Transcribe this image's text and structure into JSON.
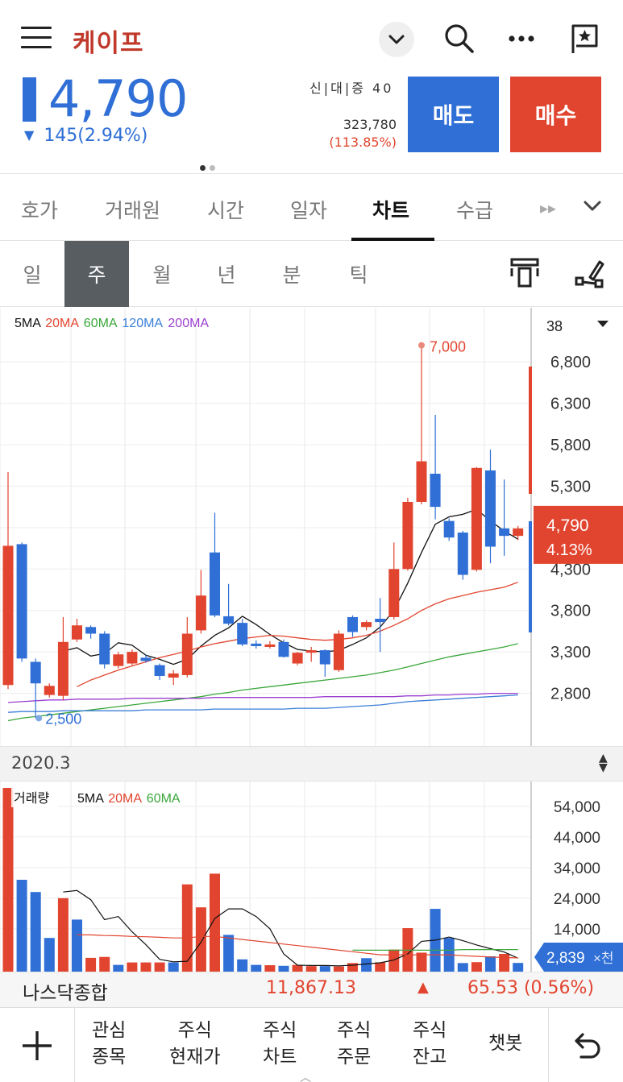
{
  "header": {
    "stock_name": "케이프",
    "icons": [
      "menu-icon",
      "chevron-down-icon",
      "search-icon",
      "more-icon",
      "bookmark-star-icon"
    ]
  },
  "quote": {
    "price": "4,790",
    "change": "145(2.94%)",
    "direction": "down",
    "credit_label": "신|대|증",
    "credit_value": "40",
    "volume": "323,780",
    "volume_pct": "(113.85%)",
    "sell_label": "매도",
    "buy_label": "매수",
    "colors": {
      "up": "#e2452f",
      "down": "#2f6fd6"
    }
  },
  "tabs": [
    {
      "label": "호가",
      "active": false
    },
    {
      "label": "거래원",
      "active": false
    },
    {
      "label": "시간",
      "active": false
    },
    {
      "label": "일자",
      "active": false
    },
    {
      "label": "차트",
      "active": true
    },
    {
      "label": "수급",
      "active": false
    }
  ],
  "periods": [
    {
      "label": "일",
      "active": false
    },
    {
      "label": "주",
      "active": true
    },
    {
      "label": "월",
      "active": false
    },
    {
      "label": "년",
      "active": false
    },
    {
      "label": "분",
      "active": false
    },
    {
      "label": "틱",
      "active": false
    }
  ],
  "price_chart": {
    "ma_legend": [
      {
        "label": "5MA",
        "color": "#111111"
      },
      {
        "label": "20MA",
        "color": "#e2452f"
      },
      {
        "label": "60MA",
        "color": "#3aa63a"
      },
      {
        "label": "120MA",
        "color": "#3b7fd8"
      },
      {
        "label": "200MA",
        "color": "#9b3fd0"
      }
    ],
    "candle_count": "38",
    "max_label": "7,000",
    "min_label": "2,500",
    "current_price": "4,790",
    "current_pct": "4.13%"
  },
  "date_bar": {
    "label": "2020.3"
  },
  "volume_chart": {
    "title": "거래량",
    "ma_legend": [
      {
        "label": "5MA",
        "color": "#111111"
      },
      {
        "label": "20MA",
        "color": "#e2452f"
      },
      {
        "label": "60MA",
        "color": "#3aa63a"
      }
    ],
    "current_volume": "2,839",
    "unit": "×천"
  },
  "chart_data": [
    {
      "type": "candlestick",
      "y_ticks": [
        6800,
        6300,
        5800,
        5300,
        4800,
        4300,
        3800,
        3300,
        2800
      ],
      "y_tick_labels": [
        "6,800",
        "6,300",
        "5,800",
        "5,300",
        "",
        "4,300",
        "3,800",
        "3,300",
        "2,800"
      ],
      "ylim": [
        2300,
        7200
      ],
      "candles": [
        {
          "o": 2900,
          "c": 4580,
          "h": 5470,
          "l": 2850
        },
        {
          "o": 4600,
          "c": 3220,
          "h": 4620,
          "l": 3180
        },
        {
          "o": 3180,
          "c": 2920,
          "h": 3220,
          "l": 2500
        },
        {
          "o": 2780,
          "c": 2890,
          "h": 2920,
          "l": 2750
        },
        {
          "o": 2770,
          "c": 3420,
          "h": 3720,
          "l": 2720
        },
        {
          "o": 3450,
          "c": 3620,
          "h": 3700,
          "l": 3420
        },
        {
          "o": 3600,
          "c": 3520,
          "h": 3620,
          "l": 3460
        },
        {
          "o": 3520,
          "c": 3150,
          "h": 3550,
          "l": 3100
        },
        {
          "o": 3130,
          "c": 3270,
          "h": 3300,
          "l": 3100
        },
        {
          "o": 3160,
          "c": 3300,
          "h": 3330,
          "l": 3140
        },
        {
          "o": 3230,
          "c": 3190,
          "h": 3260,
          "l": 3170
        },
        {
          "o": 3140,
          "c": 3010,
          "h": 3160,
          "l": 2960
        },
        {
          "o": 2990,
          "c": 3040,
          "h": 3080,
          "l": 2900
        },
        {
          "o": 3020,
          "c": 3520,
          "h": 3720,
          "l": 2990
        },
        {
          "o": 3560,
          "c": 3980,
          "h": 4290,
          "l": 3520
        },
        {
          "o": 4500,
          "c": 3740,
          "h": 4980,
          "l": 3720
        },
        {
          "o": 3730,
          "c": 3640,
          "h": 4120,
          "l": 3620
        },
        {
          "o": 3650,
          "c": 3390,
          "h": 3700,
          "l": 3370
        },
        {
          "o": 3400,
          "c": 3370,
          "h": 3440,
          "l": 3340
        },
        {
          "o": 3360,
          "c": 3390,
          "h": 3430,
          "l": 3340
        },
        {
          "o": 3420,
          "c": 3240,
          "h": 3450,
          "l": 3230
        },
        {
          "o": 3160,
          "c": 3290,
          "h": 3300,
          "l": 3140
        },
        {
          "o": 3290,
          "c": 3320,
          "h": 3360,
          "l": 3180
        },
        {
          "o": 3320,
          "c": 3150,
          "h": 3330,
          "l": 3000
        },
        {
          "o": 3080,
          "c": 3520,
          "h": 3560,
          "l": 3060
        },
        {
          "o": 3720,
          "c": 3540,
          "h": 3740,
          "l": 3480
        },
        {
          "o": 3600,
          "c": 3660,
          "h": 3680,
          "l": 3560
        },
        {
          "o": 3700,
          "c": 3660,
          "h": 3950,
          "l": 3300
        },
        {
          "o": 3720,
          "c": 4300,
          "h": 4620,
          "l": 3690
        },
        {
          "o": 4300,
          "c": 5110,
          "h": 5160,
          "l": 4280
        },
        {
          "o": 5110,
          "c": 5600,
          "h": 7000,
          "l": 5080
        },
        {
          "o": 5450,
          "c": 5050,
          "h": 6160,
          "l": 4900
        },
        {
          "o": 4880,
          "c": 4680,
          "h": 4910,
          "l": 4640
        },
        {
          "o": 4740,
          "c": 4230,
          "h": 4760,
          "l": 4170
        },
        {
          "o": 4290,
          "c": 5520,
          "h": 5530,
          "l": 4270
        },
        {
          "o": 5490,
          "c": 4570,
          "h": 5740,
          "l": 4370
        },
        {
          "o": 4790,
          "c": 4700,
          "h": 5380,
          "l": 4460
        },
        {
          "o": 4700,
          "c": 4790,
          "h": 4820,
          "l": 4650
        }
      ],
      "ma": {
        "ma5": [
          null,
          null,
          null,
          null,
          3310,
          3350,
          3250,
          3280,
          3410,
          3380,
          3260,
          3210,
          3150,
          3210,
          3370,
          3500,
          3590,
          3730,
          3630,
          3510,
          3410,
          3330,
          3310,
          3300,
          3320,
          3390,
          3470,
          3600,
          3800,
          4130,
          4500,
          4840,
          4930,
          4960,
          5020,
          4880,
          4760,
          4660
        ],
        "ma20": [
          null,
          null,
          null,
          null,
          null,
          2880,
          2960,
          3020,
          3080,
          3130,
          3180,
          3230,
          3270,
          3310,
          3360,
          3400,
          3430,
          3460,
          3480,
          3500,
          3490,
          3470,
          3450,
          3440,
          3450,
          3470,
          3500,
          3550,
          3620,
          3700,
          3800,
          3880,
          3940,
          3980,
          4020,
          4050,
          4080,
          4140
        ],
        "ma60": [
          2470,
          2500,
          2520,
          2540,
          2560,
          2580,
          2600,
          2620,
          2640,
          2660,
          2680,
          2700,
          2720,
          2740,
          2760,
          2790,
          2810,
          2840,
          2860,
          2880,
          2900,
          2920,
          2940,
          2960,
          2980,
          3000,
          3020,
          3050,
          3080,
          3120,
          3160,
          3200,
          3240,
          3270,
          3300,
          3330,
          3360,
          3400
        ],
        "ma120": [
          2570,
          2580,
          2580,
          2580,
          2590,
          2590,
          2590,
          2590,
          2590,
          2590,
          2600,
          2600,
          2600,
          2600,
          2600,
          2610,
          2610,
          2610,
          2610,
          2610,
          2610,
          2620,
          2620,
          2620,
          2630,
          2640,
          2650,
          2660,
          2680,
          2700,
          2710,
          2720,
          2730,
          2740,
          2750,
          2760,
          2770,
          2780
        ],
        "ma200": [
          2690,
          2700,
          2710,
          2720,
          2720,
          2730,
          2730,
          2730,
          2730,
          2740,
          2740,
          2740,
          2740,
          2740,
          2740,
          2750,
          2750,
          2750,
          2750,
          2750,
          2750,
          2750,
          2750,
          2760,
          2760,
          2760,
          2760,
          2760,
          2760,
          2770,
          2770,
          2780,
          2780,
          2790,
          2790,
          2800,
          2800,
          2800
        ]
      }
    },
    {
      "type": "bar",
      "title": "거래량",
      "y_ticks": [
        54000,
        44000,
        34000,
        24000,
        14000
      ],
      "y_tick_labels": [
        "54,000",
        "44,000",
        "34,000",
        "24,000",
        "14,000"
      ],
      "ylim": [
        0,
        60000
      ],
      "values": [
        60000,
        30000,
        26000,
        11000,
        24000,
        17000,
        4500,
        4800,
        2200,
        3000,
        3000,
        3000,
        3000,
        28500,
        21000,
        32000,
        12000,
        4000,
        2200,
        2100,
        1900,
        2200,
        1800,
        1800,
        1700,
        2800,
        4400,
        3000,
        7200,
        14200,
        6200,
        20500,
        11000,
        2800,
        3100,
        5000,
        5800,
        2839
      ],
      "up": [
        1,
        0,
        0,
        0,
        1,
        0,
        1,
        1,
        0,
        1,
        1,
        1,
        0,
        1,
        1,
        1,
        0,
        0,
        0,
        1,
        0,
        1,
        1,
        0,
        1,
        1,
        0,
        1,
        1,
        1,
        1,
        0,
        0,
        0,
        1,
        0,
        1,
        0
      ],
      "ma5": [
        null,
        null,
        null,
        null,
        26000,
        26500,
        23500,
        17000,
        18000,
        13000,
        8800,
        4000,
        3200,
        3400,
        9600,
        17400,
        20500,
        20500,
        18000,
        14000,
        5800,
        2100,
        2000,
        2000,
        1900,
        2100,
        2500,
        2900,
        3800,
        5800,
        9900,
        10300,
        11300,
        10100,
        8700,
        7500,
        6400,
        4400
      ],
      "ma20": [
        null,
        null,
        null,
        null,
        null,
        12000,
        12000,
        11800,
        11700,
        11500,
        11400,
        11200,
        11000,
        11000,
        11500,
        11500,
        11000,
        10500,
        10000,
        9500,
        9000,
        8500,
        8000,
        7500,
        7000,
        6500,
        6000,
        5500,
        5500,
        5500,
        5500,
        5500,
        5500,
        5200,
        5000,
        4800,
        4600,
        4500
      ],
      "ma60": [
        null,
        null,
        null,
        null,
        null,
        null,
        null,
        null,
        null,
        null,
        null,
        null,
        null,
        null,
        null,
        null,
        null,
        null,
        null,
        null,
        null,
        null,
        null,
        null,
        null,
        7000,
        7000,
        7000,
        7000,
        7000,
        7000,
        7000,
        7000,
        7200,
        7200,
        7200,
        7200,
        7200
      ]
    }
  ],
  "index_ticker": {
    "name": "나스닥종합",
    "value": "11,867.13",
    "change": "65.53 (0.56%)"
  },
  "bottom_nav": [
    {
      "line1": "관심",
      "line2": "종목"
    },
    {
      "line1": "주식",
      "line2": "현재가"
    },
    {
      "line1": "주식",
      "line2": "차트"
    },
    {
      "line1": "주식",
      "line2": "주문"
    },
    {
      "line1": "주식",
      "line2": "잔고"
    },
    {
      "line1": "챗봇",
      "line2": ""
    }
  ]
}
